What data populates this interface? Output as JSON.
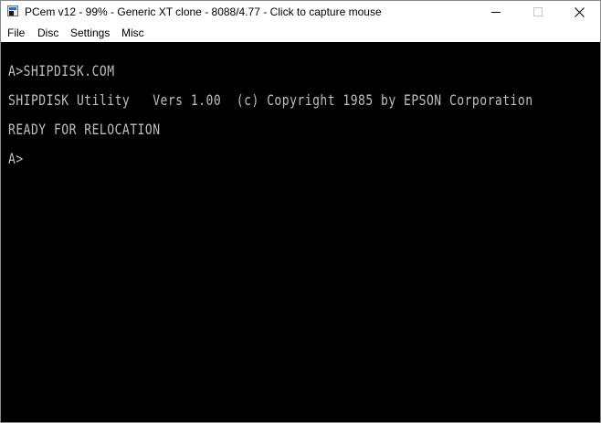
{
  "window": {
    "title": "PCem v12 - 99% - Generic XT clone - 8088/4.77 - Click to capture mouse",
    "icon": "pcem-app-icon"
  },
  "menu": {
    "items": [
      "File",
      "Disc",
      "Settings",
      "Misc"
    ]
  },
  "terminal": {
    "lines": [
      "A>SHIPDISK.COM",
      "SHIPDISK Utility   Vers 1.00  (c) Copyright 1985 by EPSON Corporation",
      "READY FOR RELOCATION",
      "A>"
    ],
    "foreground": "#bfbfbf",
    "background": "#000000"
  }
}
